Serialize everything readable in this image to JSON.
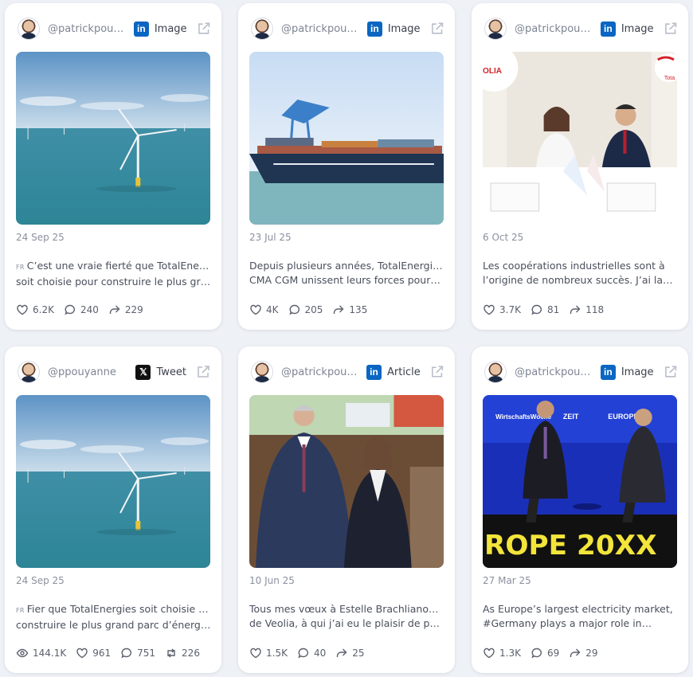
{
  "colors": {
    "background": "#eef1f6",
    "card": "#ffffff",
    "linkedin": "#0a66c2",
    "x": "#111111"
  },
  "posts": [
    {
      "handle": "@patrickpouy…",
      "source_icon": "linkedin-icon",
      "source_label": "Image",
      "image": "offshore-wind-turbine-photo",
      "date": "24 Sep 25",
      "lang": "FR",
      "text_line1": "C’est une vraie fierté que TotalEnergies",
      "text_line2": "soit choisie pour construire le plus gran…",
      "stats": {
        "likes": "6.2K",
        "comments": "240",
        "shares": "229"
      }
    },
    {
      "handle": "@patrickpouy…",
      "source_icon": "linkedin-icon",
      "source_label": "Image",
      "image": "container-ship-port-photo",
      "date": "23 Jul 25",
      "lang": "",
      "text_line1": "Depuis plusieurs années, TotalEnergies et",
      "text_line2": "CMA CGM unissent leurs forces pour…",
      "stats": {
        "likes": "4K",
        "comments": "205",
        "shares": "135"
      }
    },
    {
      "handle": "@patrickpouy…",
      "source_icon": "linkedin-icon",
      "source_label": "Image",
      "image": "signing-ceremony-photo",
      "date": "6 Oct 25",
      "lang": "",
      "text_line1": "Les coopérations industrielles sont à",
      "text_line2": "l’origine de nombreux succès. J’ai la…",
      "stats": {
        "likes": "3.7K",
        "comments": "81",
        "shares": "118"
      }
    },
    {
      "handle": "@ppouyanne",
      "source_icon": "x-icon",
      "source_label": "Tweet",
      "image": "offshore-wind-turbine-photo",
      "date": "24 Sep 25",
      "lang": "FR",
      "text_line1": "Fier que TotalEnergies soit choisie pour",
      "text_line2": "construire le plus grand parc d’énergie…",
      "stats": {
        "views": "144.1K",
        "likes": "961",
        "comments": "751",
        "retweets": "226"
      }
    },
    {
      "handle": "@patrickpouy…",
      "source_icon": "linkedin-icon",
      "source_label": "Article",
      "image": "two-executives-photo",
      "date": "10 Jun 25",
      "lang": "",
      "text_line1": "Tous mes vœux à Estelle Brachlianoff, DG",
      "text_line2": "de Veolia, à qui j’ai eu le plaisir de passe…",
      "stats": {
        "likes": "1.5K",
        "comments": "40",
        "shares": "25"
      }
    },
    {
      "handle": "@patrickpouy…",
      "source_icon": "linkedin-icon",
      "source_label": "Image",
      "image": "conference-stage-photo",
      "date": "27 Mar 25",
      "lang": "",
      "text_line1": "As Europe’s largest electricity market,",
      "text_line2": "#Germany plays a major role in…",
      "stats": {
        "likes": "1.3K",
        "comments": "69",
        "shares": "29"
      }
    }
  ],
  "image_text": {
    "veolia_banner": "OLIA",
    "total_banner": "Tota",
    "stage_logo": "WirtschaftsWoche",
    "stage_zeit": "ZEIT",
    "stage_europe": "EUROPE",
    "stage_big": "ROPE 20XX"
  }
}
